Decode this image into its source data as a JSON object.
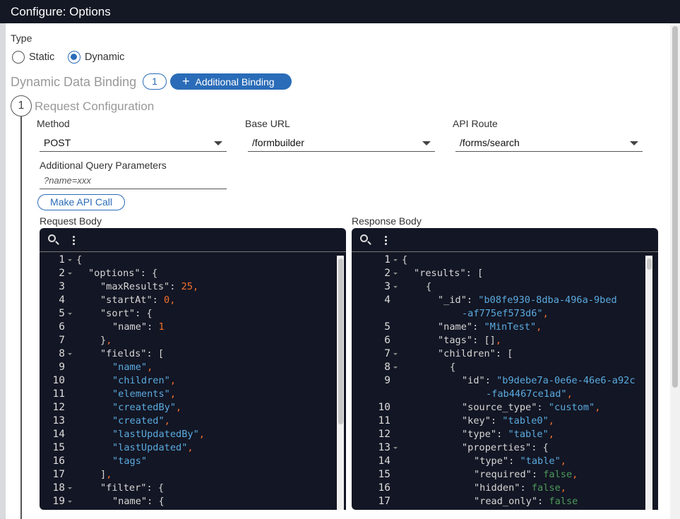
{
  "title": "Configure: Options",
  "type": {
    "label": "Type",
    "options": [
      "Static",
      "Dynamic"
    ],
    "selected": "Dynamic"
  },
  "binding": {
    "title": "Dynamic Data Binding",
    "count": "1",
    "add_label": "Additional Binding",
    "add_icon": "plus-icon"
  },
  "step": {
    "number": "1",
    "title": "Request Configuration"
  },
  "method": {
    "label": "Method",
    "value": "POST"
  },
  "base_url": {
    "label": "Base URL",
    "value": "/formbuilder"
  },
  "api_route": {
    "label": "API Route",
    "value": "/forms/search"
  },
  "query": {
    "label": "Additional Query Parameters",
    "placeholder": "?name=xxx"
  },
  "make_call_label": "Make API Call",
  "request": {
    "label": "Request Body",
    "lines": [
      {
        "n": "1",
        "f": 1,
        "i": 0,
        "t": [
          [
            "p",
            "{"
          ]
        ]
      },
      {
        "n": "2",
        "f": 1,
        "i": 1,
        "t": [
          [
            "k",
            "\"options\": {"
          ]
        ]
      },
      {
        "n": "3",
        "i": 2,
        "t": [
          [
            "k",
            "\"maxResults\": "
          ],
          [
            "n",
            "25"
          ],
          [
            "c",
            ","
          ]
        ]
      },
      {
        "n": "4",
        "i": 2,
        "t": [
          [
            "k",
            "\"startAt\": "
          ],
          [
            "n",
            "0"
          ],
          [
            "c",
            ","
          ]
        ]
      },
      {
        "n": "5",
        "f": 1,
        "i": 2,
        "t": [
          [
            "k",
            "\"sort\": {"
          ]
        ]
      },
      {
        "n": "6",
        "i": 3,
        "t": [
          [
            "k",
            "\"name\": "
          ],
          [
            "n",
            "1"
          ]
        ]
      },
      {
        "n": "7",
        "i": 2,
        "t": [
          [
            "k",
            "}"
          ],
          [
            "c",
            ","
          ]
        ]
      },
      {
        "n": "8",
        "f": 1,
        "i": 2,
        "t": [
          [
            "k",
            "\"fields\": ["
          ]
        ]
      },
      {
        "n": "9",
        "i": 3,
        "t": [
          [
            "s",
            "\"name\""
          ],
          [
            "c",
            ","
          ]
        ]
      },
      {
        "n": "10",
        "i": 3,
        "t": [
          [
            "s",
            "\"children\""
          ],
          [
            "c",
            ","
          ]
        ]
      },
      {
        "n": "11",
        "i": 3,
        "t": [
          [
            "s",
            "\"elements\""
          ],
          [
            "c",
            ","
          ]
        ]
      },
      {
        "n": "12",
        "i": 3,
        "t": [
          [
            "s",
            "\"createdBy\""
          ],
          [
            "c",
            ","
          ]
        ]
      },
      {
        "n": "13",
        "i": 3,
        "t": [
          [
            "s",
            "\"created\""
          ],
          [
            "c",
            ","
          ]
        ]
      },
      {
        "n": "14",
        "i": 3,
        "t": [
          [
            "s",
            "\"lastUpdatedBy\""
          ],
          [
            "c",
            ","
          ]
        ]
      },
      {
        "n": "15",
        "i": 3,
        "t": [
          [
            "s",
            "\"lastUpdated\""
          ],
          [
            "c",
            ","
          ]
        ]
      },
      {
        "n": "16",
        "i": 3,
        "t": [
          [
            "s",
            "\"tags\""
          ]
        ]
      },
      {
        "n": "17",
        "i": 2,
        "t": [
          [
            "k",
            "]"
          ],
          [
            "c",
            ","
          ]
        ]
      },
      {
        "n": "18",
        "f": 1,
        "i": 2,
        "t": [
          [
            "k",
            "\"filter\": {"
          ]
        ]
      },
      {
        "n": "19",
        "f": 1,
        "i": 3,
        "t": [
          [
            "k",
            "\"name\": {"
          ]
        ]
      }
    ]
  },
  "response": {
    "label": "Response Body",
    "lines": [
      {
        "n": "1",
        "f": 1,
        "i": 0,
        "t": [
          [
            "p",
            "{"
          ]
        ]
      },
      {
        "n": "2",
        "f": 1,
        "i": 1,
        "t": [
          [
            "k",
            "\"results\": ["
          ]
        ]
      },
      {
        "n": "3",
        "f": 1,
        "i": 2,
        "t": [
          [
            "k",
            "{"
          ]
        ]
      },
      {
        "n": "4",
        "i": 3,
        "t": [
          [
            "k",
            "\"_id\": "
          ],
          [
            "s",
            "\"b08fe930-8dba-496a-9bed"
          ]
        ]
      },
      {
        "n": "",
        "i": 5,
        "t": [
          [
            "s",
            "-af775ef573d6\""
          ],
          [
            "c",
            ","
          ]
        ]
      },
      {
        "n": "5",
        "i": 3,
        "t": [
          [
            "k",
            "\"name\": "
          ],
          [
            "s",
            "\"MinTest\""
          ],
          [
            "c",
            ","
          ]
        ]
      },
      {
        "n": "6",
        "i": 3,
        "t": [
          [
            "k",
            "\"tags\": []"
          ],
          [
            "c",
            ","
          ]
        ]
      },
      {
        "n": "7",
        "f": 1,
        "i": 3,
        "t": [
          [
            "k",
            "\"children\": ["
          ]
        ]
      },
      {
        "n": "8",
        "f": 1,
        "i": 4,
        "t": [
          [
            "k",
            "{"
          ]
        ]
      },
      {
        "n": "9",
        "i": 5,
        "t": [
          [
            "k",
            "\"id\": "
          ],
          [
            "s",
            "\"b9debe7a-0e6e-46e6-a92c"
          ]
        ]
      },
      {
        "n": "",
        "i": 7,
        "t": [
          [
            "s",
            "-fab4467ce1ad\""
          ],
          [
            "c",
            ","
          ]
        ]
      },
      {
        "n": "10",
        "i": 5,
        "t": [
          [
            "k",
            "\"source_type\": "
          ],
          [
            "s",
            "\"custom\""
          ],
          [
            "c",
            ","
          ]
        ]
      },
      {
        "n": "11",
        "i": 5,
        "t": [
          [
            "k",
            "\"key\": "
          ],
          [
            "s",
            "\"table0\""
          ],
          [
            "c",
            ","
          ]
        ]
      },
      {
        "n": "12",
        "i": 5,
        "t": [
          [
            "k",
            "\"type\": "
          ],
          [
            "s",
            "\"table\""
          ],
          [
            "c",
            ","
          ]
        ]
      },
      {
        "n": "13",
        "f": 1,
        "i": 5,
        "t": [
          [
            "k",
            "\"properties\": {"
          ]
        ]
      },
      {
        "n": "14",
        "i": 6,
        "t": [
          [
            "k",
            "\"type\": "
          ],
          [
            "s",
            "\"table\""
          ],
          [
            "c",
            ","
          ]
        ]
      },
      {
        "n": "15",
        "i": 6,
        "t": [
          [
            "k",
            "\"required\": "
          ],
          [
            "b",
            "false"
          ],
          [
            "c",
            ","
          ]
        ]
      },
      {
        "n": "16",
        "i": 6,
        "t": [
          [
            "k",
            "\"hidden\": "
          ],
          [
            "b",
            "false"
          ],
          [
            "c",
            ","
          ]
        ]
      },
      {
        "n": "17",
        "i": 6,
        "t": [
          [
            "k",
            "\"read_only\": "
          ],
          [
            "b",
            "false"
          ]
        ]
      }
    ]
  },
  "colors": {
    "accent": "#2a6cb8",
    "titlebar": "#141824",
    "editor_bg": "#131624"
  }
}
